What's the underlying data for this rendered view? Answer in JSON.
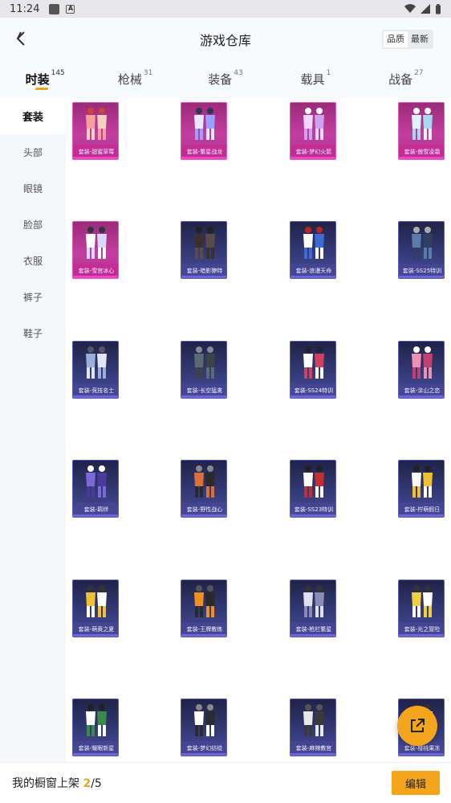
{
  "status_bar": {
    "time": "11:24"
  },
  "header": {
    "title": "游戏仓库",
    "toggle": [
      {
        "label": "品质",
        "active": true
      },
      {
        "label": "最新",
        "active": false
      }
    ]
  },
  "tabs": [
    {
      "label": "时装",
      "count": "145",
      "active": true
    },
    {
      "label": "枪械",
      "count": "31",
      "active": false
    },
    {
      "label": "装备",
      "count": "43",
      "active": false
    },
    {
      "label": "载具",
      "count": "1",
      "active": false
    },
    {
      "label": "战备",
      "count": "27",
      "active": false
    }
  ],
  "sidebar": {
    "items": [
      {
        "label": "套装",
        "active": true
      },
      {
        "label": "头部",
        "active": false
      },
      {
        "label": "眼镜",
        "active": false
      },
      {
        "label": "脸部",
        "active": false
      },
      {
        "label": "衣服",
        "active": false
      },
      {
        "label": "裤子",
        "active": false
      },
      {
        "label": "鞋子",
        "active": false
      }
    ]
  },
  "items": [
    {
      "name": "套装-甜蜜草莓",
      "rarity": "pink"
    },
    {
      "name": "套装-繁星战龙",
      "rarity": "pink"
    },
    {
      "name": "套装-梦幻火箭",
      "rarity": "pink"
    },
    {
      "name": "套装-傲雪凌霜",
      "rarity": "pink"
    },
    {
      "name": "套装-雪宫冰心",
      "rarity": "pink"
    },
    {
      "name": "套装-暗影獠特",
      "rarity": "blue"
    },
    {
      "name": "套装-浪漫天命",
      "rarity": "blue"
    },
    {
      "name": "套装-SS25特训",
      "rarity": "blue"
    },
    {
      "name": "套装-竞技名士",
      "rarity": "blue"
    },
    {
      "name": "套装-长空猛禽",
      "rarity": "blue"
    },
    {
      "name": "套装-SS24特训",
      "rarity": "blue"
    },
    {
      "name": "套装-涂山之恋",
      "rarity": "blue"
    },
    {
      "name": "套装-羁绊",
      "rarity": "blue"
    },
    {
      "name": "套装-野性战心",
      "rarity": "blue"
    },
    {
      "name": "套装-SS23特训",
      "rarity": "blue"
    },
    {
      "name": "套装-柠萌假日",
      "rarity": "blue"
    },
    {
      "name": "套装-萌黄之夏",
      "rarity": "blue"
    },
    {
      "name": "套装-王牌教练",
      "rarity": "blue"
    },
    {
      "name": "套装-枪栏繁星",
      "rarity": "blue"
    },
    {
      "name": "套装-光之冒险",
      "rarity": "blue"
    },
    {
      "name": "套装-耀眼新星",
      "rarity": "blue"
    },
    {
      "name": "套装-梦幻纺绘",
      "rarity": "blue"
    },
    {
      "name": "套装-麻辣教官",
      "rarity": "blue"
    },
    {
      "name": "套装-樱桃果冻",
      "rarity": "blue"
    }
  ],
  "bottom": {
    "text": "我的橱窗上架 ",
    "current": "2",
    "total": "/5",
    "edit_label": "编辑"
  },
  "colors": {
    "accent": "#f5a51c",
    "epic": "#c23e9f",
    "rare": "#353c7a"
  }
}
